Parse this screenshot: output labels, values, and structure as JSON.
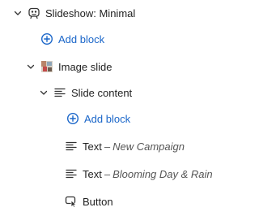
{
  "tree": {
    "slideshow": {
      "label": "Slideshow: Minimal",
      "icon": "slideshow-icon",
      "expanded": true
    },
    "add_block_1": {
      "label": "Add block",
      "icon": "plus-circle-icon"
    },
    "image_slide": {
      "label": "Image slide",
      "icon": "image-thumbnail-icon",
      "expanded": true
    },
    "slide_content": {
      "label": "Slide content",
      "icon": "align-left-icon",
      "expanded": true
    },
    "add_block_2": {
      "label": "Add block",
      "icon": "plus-circle-icon"
    },
    "text_1": {
      "label": "Text",
      "dash": "–",
      "sublabel": "New Campaign",
      "icon": "text-lines-icon"
    },
    "text_2": {
      "label": "Text",
      "dash": "–",
      "sublabel": "Blooming Day & Rain",
      "icon": "text-lines-icon"
    },
    "button": {
      "label": "Button",
      "icon": "cursor-click-icon"
    }
  },
  "colors": {
    "accent": "#1a66c9",
    "text": "#1f1f1f",
    "muted": "#555555",
    "icon": "#333333"
  }
}
